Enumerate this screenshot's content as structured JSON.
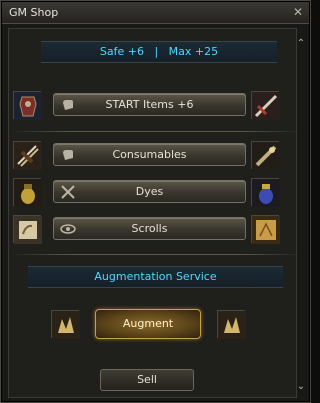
{
  "window": {
    "title": "GM Shop"
  },
  "info": {
    "safe": "Safe +6",
    "separator": "|",
    "max": "Max +25"
  },
  "categories": [
    {
      "label": "START Items +6",
      "icon": "glove-icon",
      "left_icon": "armor-icon",
      "right_icon": "sword-icon"
    },
    {
      "label": "Consumables",
      "icon": "glove-icon",
      "left_icon": "arrows-icon",
      "right_icon": "potion-icon"
    },
    {
      "label": "Dyes",
      "icon": "crossed-swords-icon",
      "left_icon": "gold-jar-icon",
      "right_icon": "blue-jar-icon"
    },
    {
      "label": "Scrolls",
      "icon": "eye-icon",
      "left_icon": "scroll-icon",
      "right_icon": "map-icon"
    }
  ],
  "augmentation": {
    "heading": "Augmentation Service",
    "button": "Augment",
    "left_icon": "crystal-icon",
    "right_icon": "crystal-icon"
  },
  "footer": {
    "sell": "Sell"
  },
  "colors": {
    "accent": "#51d7ff",
    "gold": "#c5a24a",
    "panel": "#1f1f1c"
  }
}
